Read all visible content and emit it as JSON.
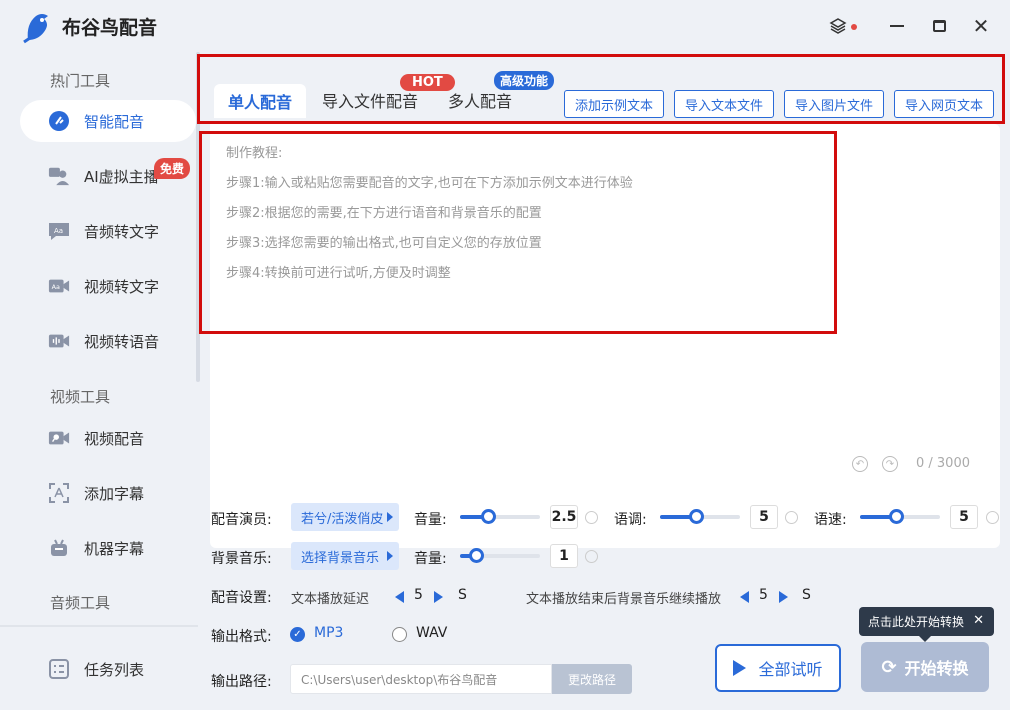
{
  "app": {
    "title": "布谷鸟配音"
  },
  "sidebar": {
    "sections": [
      "热门工具",
      "视频工具",
      "音频工具"
    ],
    "items": [
      {
        "label": "智能配音",
        "icon": "smart-dub-icon",
        "active": true
      },
      {
        "label": "AI虚拟主播",
        "icon": "ai-anchor-icon",
        "badge": "免费"
      },
      {
        "label": "音频转文字",
        "icon": "audio-to-text-icon"
      },
      {
        "label": "视频转文字",
        "icon": "video-to-text-icon"
      },
      {
        "label": "视频转语音",
        "icon": "video-to-speech-icon"
      },
      {
        "label": "视频配音",
        "icon": "video-dub-icon"
      },
      {
        "label": "添加字幕",
        "icon": "add-subtitle-icon"
      },
      {
        "label": "机器字幕",
        "icon": "machine-subtitle-icon"
      }
    ],
    "task_list": "任务列表"
  },
  "tabs": [
    {
      "label": "单人配音",
      "active": true
    },
    {
      "label": "导入文件配音",
      "badge": "HOT"
    },
    {
      "label": "多人配音",
      "badge": "高级功能"
    }
  ],
  "import_buttons": [
    "添加示例文本",
    "导入文本文件",
    "导入图片文件",
    "导入网页文本"
  ],
  "editor": {
    "guide": [
      "制作教程:",
      "步骤1:输入或粘贴您需要配音的文字,也可在下方添加示例文本进行体验",
      "步骤2:根据您的需要,在下方进行语音和背景音乐的配置",
      "步骤3:选择您需要的输出格式,也可自定义您的存放位置",
      "步骤4:转换前可进行试听,方便及时调整"
    ],
    "counter": "0 / 3000"
  },
  "settings": {
    "voice_label": "配音演员:",
    "voice_value": "若兮/活泼俏皮",
    "volume_label": "音量:",
    "volume_value": "2.5",
    "volume_level": 0.35,
    "tone_label": "语调:",
    "tone_value": "5",
    "tone_level": 0.45,
    "speed_label": "语速:",
    "speed_value": "5",
    "speed_level": 0.45,
    "bgm_label": "背景音乐:",
    "bgm_value": "选择背景音乐",
    "bgm_volume_label": "音量:",
    "bgm_volume_value": "1",
    "bgm_volume_level": 0.2,
    "dub_settings_label": "配音设置:",
    "delay_label": "文本播放延迟",
    "delay_value": "5",
    "delay_unit": "S",
    "continue_label": "文本播放结束后背景音乐继续播放",
    "continue_value": "5",
    "continue_unit": "S",
    "format_label": "输出格式:",
    "format_options": [
      "MP3",
      "WAV"
    ],
    "format_selected": "MP3",
    "path_label": "输出路径:",
    "path_value": "C:\\Users\\user\\desktop\\布谷鸟配音",
    "path_button": "更改路径"
  },
  "actions": {
    "preview": "全部试听",
    "start": "开始转换",
    "tooltip": "点击此处开始转换"
  },
  "colors": {
    "accent": "#2a6ad8",
    "hot": "#e24a43",
    "highlight": "#d20c0c"
  }
}
